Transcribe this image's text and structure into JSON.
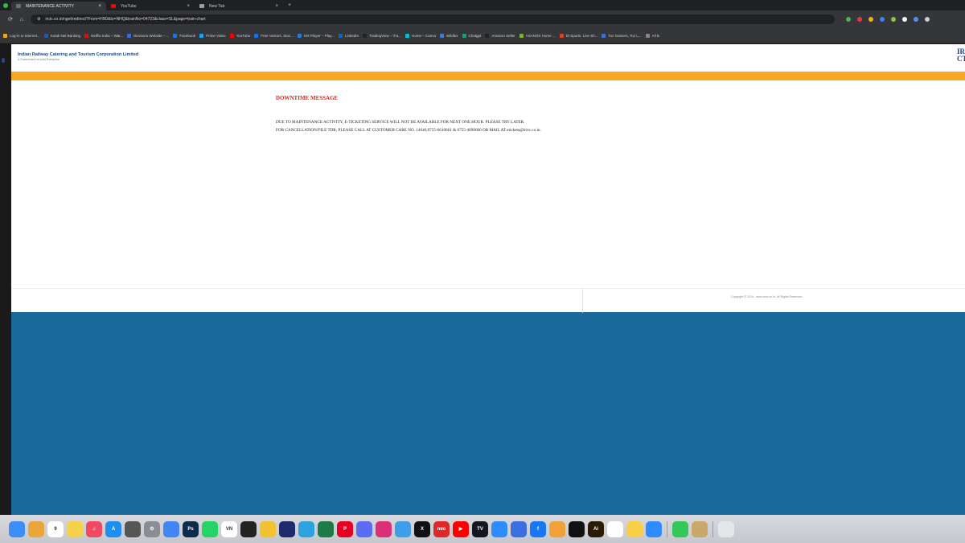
{
  "browser": {
    "tabs": [
      {
        "label": "MAINTENANCE ACTIVITY",
        "active": true,
        "favicon_color": "#6a6f7a"
      },
      {
        "label": "YouTube",
        "active": false,
        "favicon_color": "#ff0000"
      },
      {
        "label": "New Tab",
        "active": false,
        "favicon_color": "#9aa0a6"
      }
    ],
    "url": "irctc.co.in/nget/redirect?From=FBD&to=NHQ&trainNo=04723&class=SL&page=train-chart",
    "extension_colors": [
      "#4caf50",
      "#e23a3a",
      "#f0ad1b",
      "#3b82f6",
      "#8bc34a",
      "#ffffff",
      "#5a8dee",
      "#cccccc"
    ],
    "bookmarks": [
      {
        "label": "Log-in to Internet...",
        "color": "#f0ad1b"
      },
      {
        "label": "Kotak Net Banking",
        "color": "#2457a6"
      },
      {
        "label": "Netflix India – Wat...",
        "color": "#e50914"
      },
      {
        "label": "Divisions Website – ...",
        "color": "#3a6ad8"
      },
      {
        "label": "Facebook",
        "color": "#1877f2"
      },
      {
        "label": "Prime Video",
        "color": "#1ea1f2"
      },
      {
        "label": "YouTube",
        "color": "#ff0000"
      },
      {
        "label": "Free Vectors, Stoc...",
        "color": "#1273eb"
      },
      {
        "label": "MX Player – Play...",
        "color": "#2a7bde"
      },
      {
        "label": "LinkedIn",
        "color": "#0a66c2"
      },
      {
        "label": "TradingView – Tra...",
        "color": "#1e222d"
      },
      {
        "label": "Home – Canva",
        "color": "#00c4cc"
      },
      {
        "label": "Wildlex",
        "color": "#3d7ae5"
      },
      {
        "label": "Chatgpt",
        "color": "#10a37f"
      },
      {
        "label": "Amazon Seller",
        "color": "#222222"
      },
      {
        "label": "ASANOX Home ...",
        "color": "#7bb32e"
      },
      {
        "label": "Di Spurts, Live Sh...",
        "color": "#d8402a"
      },
      {
        "label": "Toz Gamers, Toz L...",
        "color": "#3f6fd0"
      },
      {
        "label": "All B",
        "color": "#888888"
      }
    ]
  },
  "header": {
    "title": "Indian Railway Catering and Tourism Corporation Limited",
    "subtitle": "A Government of India Enterprise",
    "right_logo_text": "IR CT"
  },
  "main": {
    "heading": "DOWNTIME MESSAGE",
    "line1": "DUE TO MAINTENANCE ACTIVITY, E-TICKETING SERVICE WILL NOT BE AVAILABLE FOR NEXT ONE HOUR. PLEASE TRY LATER.",
    "line2": "FOR CANCELLATION/FILE TDR, PLEASE CALL AT CUSTOMER CARE NO. 14646,0755-6610661 & 0755-4090600 OR MAIL AT etickets@irctc.co.in."
  },
  "footer": {
    "copyright": "Copyright © 2019 - www.irctc.co.in. All Rights Reserved"
  },
  "dock": {
    "apps": [
      {
        "name": "finder",
        "color": "#3e8ef7",
        "glyph": ""
      },
      {
        "name": "launchpad",
        "color": "#e9a73b",
        "glyph": ""
      },
      {
        "name": "calendar",
        "color": "#ffffff",
        "glyph": "9"
      },
      {
        "name": "notes",
        "color": "#f6d24a",
        "glyph": ""
      },
      {
        "name": "music",
        "color": "#f24862",
        "glyph": "♫"
      },
      {
        "name": "app-store",
        "color": "#1f8ef1",
        "glyph": "A"
      },
      {
        "name": "calculator",
        "color": "#555555",
        "glyph": ""
      },
      {
        "name": "system-settings",
        "color": "#8a8d93",
        "glyph": "⚙"
      },
      {
        "name": "chrome",
        "color": "#4285f4",
        "glyph": ""
      },
      {
        "name": "photoshop",
        "color": "#0d2b4a",
        "glyph": "Ps"
      },
      {
        "name": "whatsapp",
        "color": "#25d366",
        "glyph": ""
      },
      {
        "name": "vn-editor",
        "color": "#ffffff",
        "glyph": "VN"
      },
      {
        "name": "capcut",
        "color": "#222222",
        "glyph": ""
      },
      {
        "name": "photos",
        "color": "#f2c230",
        "glyph": ""
      },
      {
        "name": "one-app",
        "color": "#1d2a6b",
        "glyph": ""
      },
      {
        "name": "telegram",
        "color": "#2aa3e0",
        "glyph": ""
      },
      {
        "name": "excel",
        "color": "#1e7b45",
        "glyph": ""
      },
      {
        "name": "pinterest",
        "color": "#e60023",
        "glyph": "P"
      },
      {
        "name": "messenger",
        "color": "#5b6cf5",
        "glyph": ""
      },
      {
        "name": "instagram",
        "color": "#d93078",
        "glyph": ""
      },
      {
        "name": "mail-stats",
        "color": "#3e9ee8",
        "glyph": ""
      },
      {
        "name": "x",
        "color": "#111111",
        "glyph": "X"
      },
      {
        "name": "neo",
        "color": "#e02828",
        "glyph": "neo"
      },
      {
        "name": "youtube",
        "color": "#ff0000",
        "glyph": "▶"
      },
      {
        "name": "tradingview",
        "color": "#131722",
        "glyph": "TV"
      },
      {
        "name": "zoom-app",
        "color": "#2d8cff",
        "glyph": ""
      },
      {
        "name": "vpn",
        "color": "#3b6fe0",
        "glyph": ""
      },
      {
        "name": "facebook",
        "color": "#1877f2",
        "glyph": "f"
      },
      {
        "name": "shortcut",
        "color": "#f0a13a",
        "glyph": ""
      },
      {
        "name": "tiktok",
        "color": "#111111",
        "glyph": ""
      },
      {
        "name": "illustrator",
        "color": "#2b1a05",
        "glyph": "Ai"
      },
      {
        "name": "chatgpt",
        "color": "#ffffff",
        "glyph": ""
      },
      {
        "name": "notes-yellow",
        "color": "#f7d046",
        "glyph": ""
      },
      {
        "name": "zoom",
        "color": "#2d8cff",
        "glyph": ""
      },
      {
        "name": "facetime",
        "color": "#34c759",
        "glyph": ""
      },
      {
        "name": "folder",
        "color": "#c9a86a",
        "glyph": ""
      },
      {
        "name": "trash",
        "color": "#e5e6ea",
        "glyph": ""
      }
    ]
  }
}
